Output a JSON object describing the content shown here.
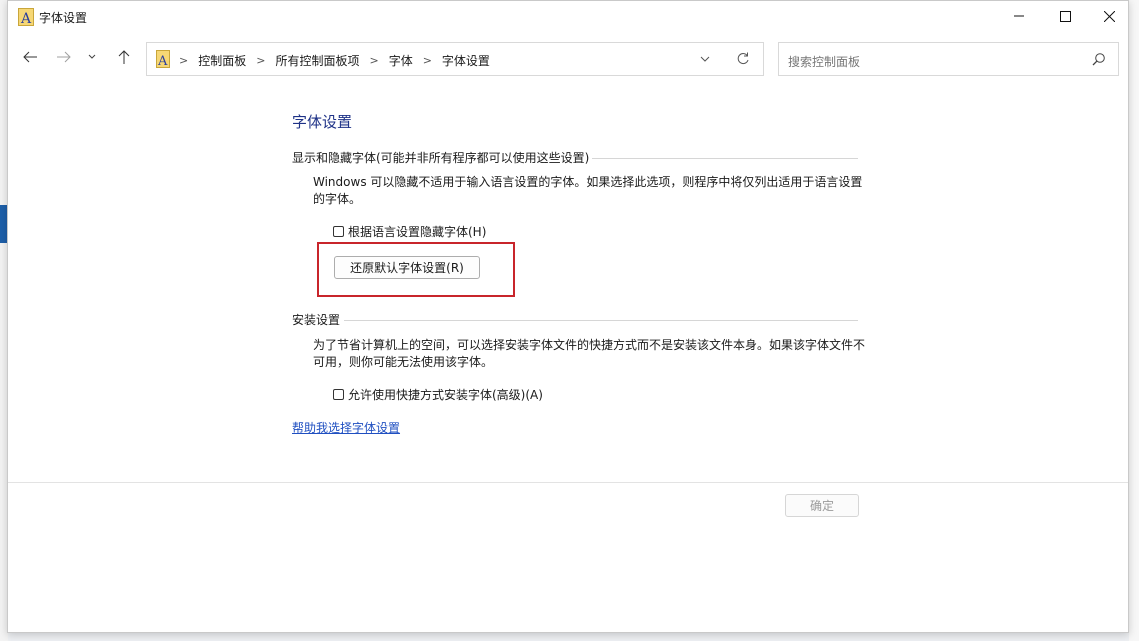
{
  "window": {
    "title": "字体设置"
  },
  "nav": {
    "breadcrumb": [
      "控制面板",
      "所有控制面板项",
      "字体",
      "字体设置"
    ],
    "search_placeholder": "搜索控制面板"
  },
  "page": {
    "title": "字体设置",
    "show_hide": {
      "heading": "显示和隐藏字体(可能并非所有程序都可以使用这些设置)",
      "description": "Windows 可以隐藏不适用于输入语言设置的字体。如果选择此选项，则程序中将仅列出适用于语言设置的字体。",
      "checkbox_label": "根据语言设置隐藏字体(H)",
      "checkbox_checked": false,
      "restore_button": "还原默认字体设置(R)"
    },
    "install": {
      "heading": "安装设置",
      "description": "为了节省计算机上的空间，可以选择安装字体文件的快捷方式而不是安装该文件本身。如果该字体文件不可用，则你可能无法使用该字体。",
      "checkbox_label": "允许使用快捷方式安装字体(高级)(A)",
      "checkbox_checked": false
    },
    "help_link": "帮助我选择字体设置",
    "ok_button": "确定"
  },
  "colors": {
    "title_blue": "#1e3287",
    "link_blue": "#1f4fc1",
    "highlight_red": "#c8252b"
  },
  "icons": [
    "font-app-icon",
    "minimize-icon",
    "maximize-icon",
    "close-icon",
    "back-arrow-icon",
    "forward-arrow-icon",
    "recent-dropdown-icon",
    "up-arrow-icon",
    "chevron-down-icon",
    "refresh-icon",
    "search-icon"
  ]
}
